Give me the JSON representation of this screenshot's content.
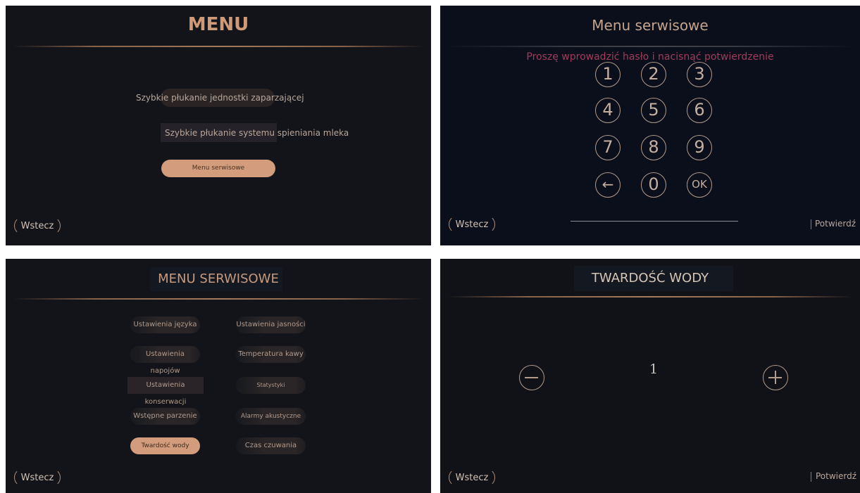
{
  "menu": {
    "title": "MENU",
    "items": [
      "Szybkie płukanie jednostki zaparzającej",
      "Szybkie płukanie systemu spieniania mleka",
      "Menu serwisowe"
    ],
    "back_label": "Wstecz"
  },
  "password": {
    "title": "Menu serwisowe",
    "prompt": "Proszę wprowadzić hasło i nacisnąć potwierdzenie",
    "keys": [
      "1",
      "2",
      "3",
      "4",
      "5",
      "6",
      "7",
      "8",
      "9",
      "←",
      "0",
      "OK"
    ],
    "back_label": "Wstecz",
    "confirm_label": "Potwierdź"
  },
  "service": {
    "title": "MENU SERWISOWE",
    "left_items": [
      "Ustawienia języka",
      "Ustawienia napojów",
      "Ustawienia konserwacji",
      "Wstępne parzenie",
      "Twardość wody"
    ],
    "right_items": [
      "Ustawienia jasności",
      "Temperatura kawy",
      "Statystyki",
      "Alarmy akustyczne",
      "Czas czuwania"
    ],
    "active_item": "Twardość wody",
    "back_label": "Wstecz"
  },
  "hardness": {
    "title": "TWARDOŚĆ WODY",
    "value": "1",
    "back_label": "Wstecz",
    "confirm_label": "Potwierdź"
  },
  "colors": {
    "accent": "#d39c7c",
    "title_text": "#c69a7e",
    "prompt_text": "#a03c5a",
    "panel_bg": "#121419"
  }
}
